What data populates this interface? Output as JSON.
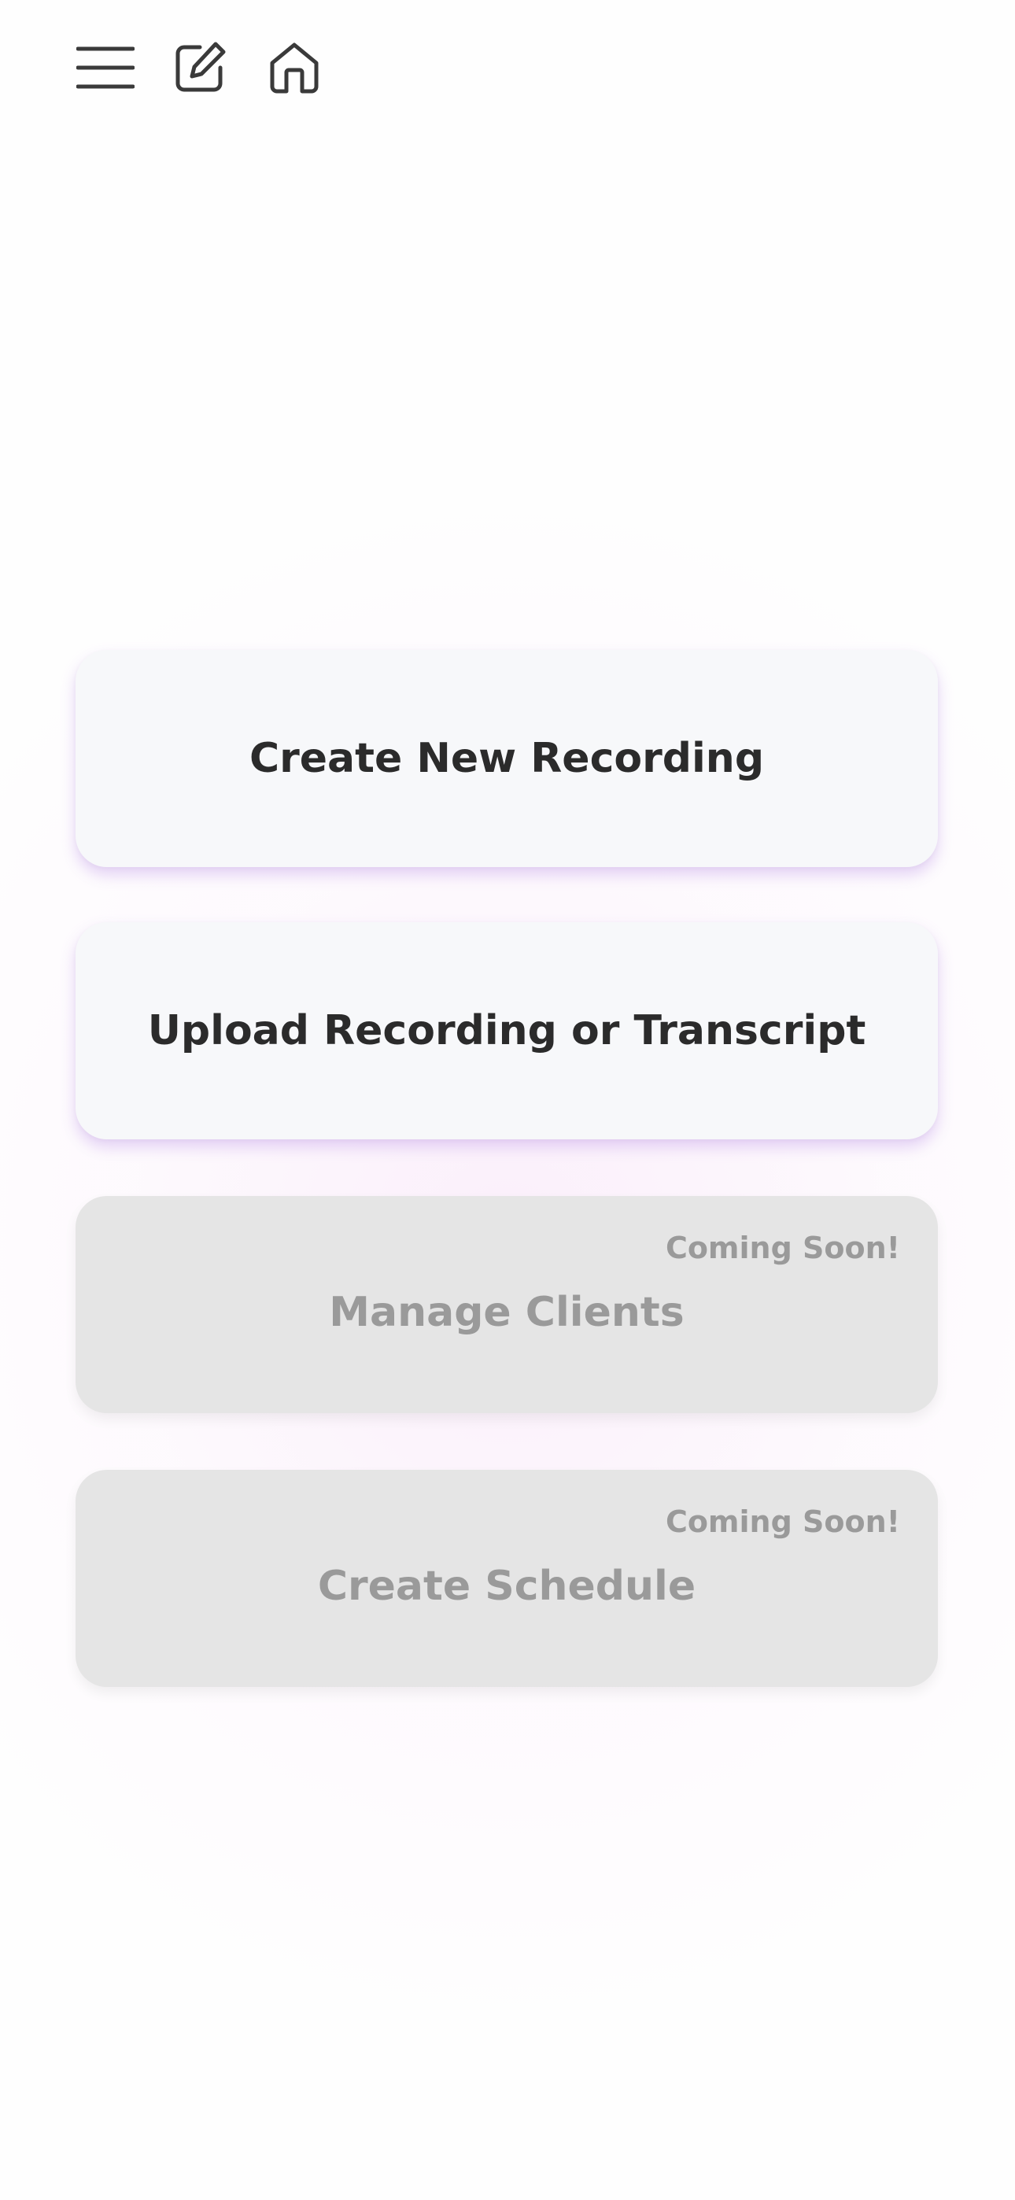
{
  "toolbar": {
    "icons": [
      "menu-icon",
      "edit-icon",
      "home-icon"
    ]
  },
  "actions": [
    {
      "label": "Create New Recording",
      "enabled": true
    },
    {
      "label": "Upload Recording or Transcript",
      "enabled": true
    },
    {
      "label": "Manage Clients",
      "enabled": false,
      "badge": "Coming Soon!"
    },
    {
      "label": "Create Schedule",
      "enabled": false,
      "badge": "Coming Soon!"
    }
  ],
  "colors": {
    "text_primary": "#2b2b2b",
    "text_disabled": "#9a9a9a",
    "card_active": "#f7f8fa",
    "card_disabled": "#e5e5e5",
    "accent_shadow": "#c6a0ec"
  }
}
